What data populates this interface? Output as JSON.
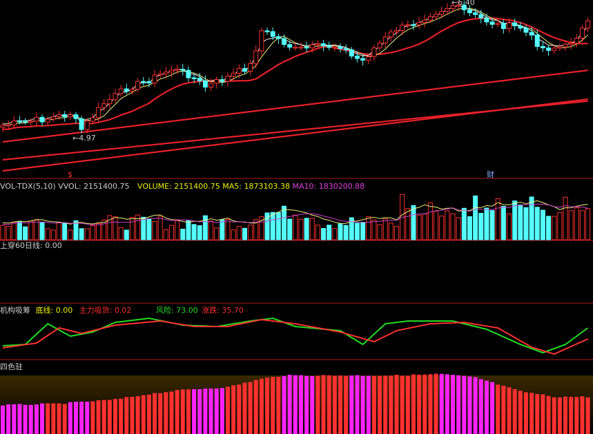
{
  "price_panel": {
    "high_label": "6.40",
    "low_label": "4.97",
    "marker_dollar": "$",
    "marker_fin": "财"
  },
  "volume_panel": {
    "name": "VOL-TDX(5,10)",
    "vol": "VVOL: 2151400.75",
    "volume": "VOLUME: 2151400.75",
    "ma5": "MA5: 1873103.38",
    "ma10": "MA10: 1830200.88"
  },
  "cross60_panel": {
    "name": "上穿60日线",
    "value": ": 0.00"
  },
  "inst_panel": {
    "name": "机构吸筹",
    "bottom": "底线: 0.00",
    "main": "主力吸货: 0.02",
    "risk": "风险: 73.00",
    "change": "涨跌: 35.70"
  },
  "four_color_panel": {
    "name": "四色驻"
  },
  "colors": {
    "up": "#ff3030",
    "down": "#54ffff",
    "ma_red": "#e8202a",
    "ma_yellow": "#f0f07a",
    "ma_white": "#e8e8e8",
    "ma10": "#d040d0",
    "green": "#22dd22",
    "magenta": "#ff22ff",
    "label_yellow": "#f0f000",
    "label_red": "#ff4040"
  }
}
